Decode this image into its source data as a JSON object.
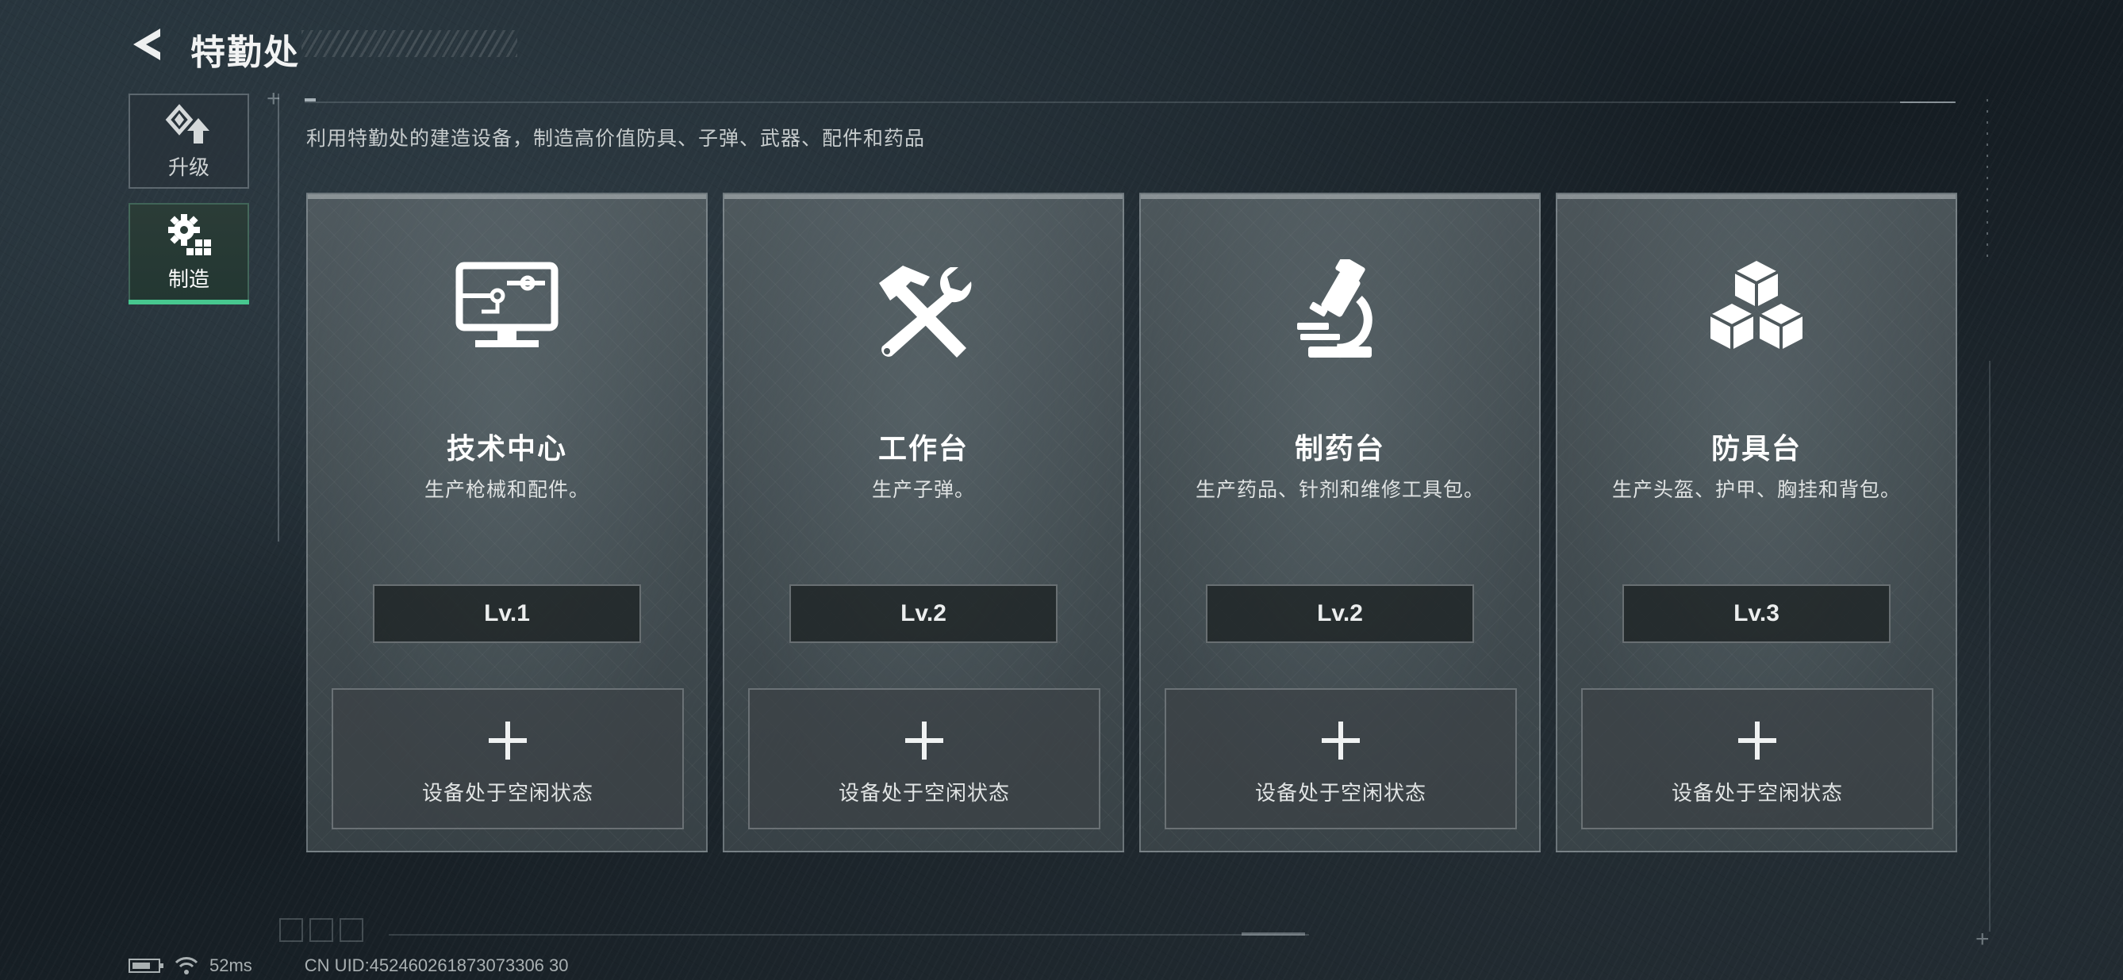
{
  "header": {
    "title": "特勤处"
  },
  "sidebar": {
    "tabs": [
      {
        "label": "升级",
        "icon": "upgrade-icon",
        "active": false
      },
      {
        "label": "制造",
        "icon": "gear-grid-icon",
        "active": true
      }
    ]
  },
  "main": {
    "description": "利用特勤处的建造设备，制造高价值防具、子弹、武器、配件和药品",
    "cards": [
      {
        "icon": "monitor-circuit-icon",
        "title": "技术中心",
        "desc": "生产枪械和配件。",
        "level": "Lv.1",
        "status": "设备处于空闲状态"
      },
      {
        "icon": "hammer-wrench-icon",
        "title": "工作台",
        "desc": "生产子弹。",
        "level": "Lv.2",
        "status": "设备处于空闲状态"
      },
      {
        "icon": "microscope-icon",
        "title": "制药台",
        "desc": "生产药品、针剂和维修工具包。",
        "level": "Lv.2",
        "status": "设备处于空闲状态"
      },
      {
        "icon": "stacked-cubes-icon",
        "title": "防具台",
        "desc": "生产头盔、护甲、胸挂和背包。",
        "level": "Lv.3",
        "status": "设备处于空闲状态"
      }
    ]
  },
  "status_bar": {
    "ping": "52ms",
    "uid": "CN UID:452460261873073306 30"
  },
  "colors": {
    "accent_active": "#47c78f",
    "card_bg": "#565f63",
    "background": "#1a2328"
  }
}
